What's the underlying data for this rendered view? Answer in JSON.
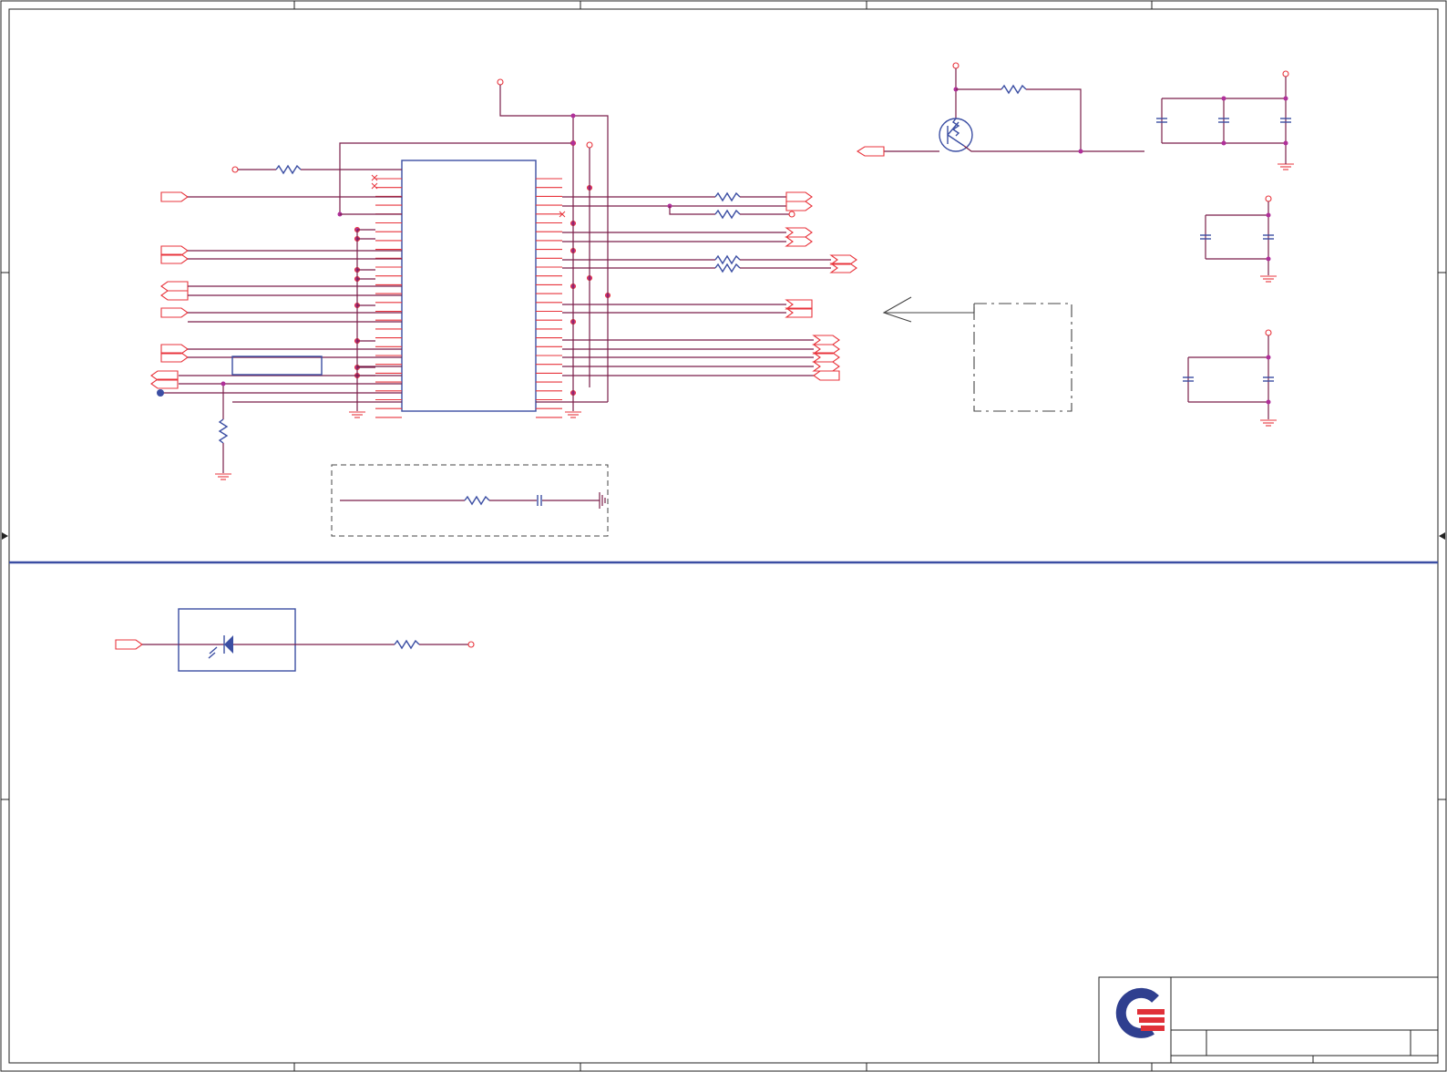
{
  "sheet": {
    "type": "schematic",
    "colors": {
      "wire": "#7a1f4a",
      "pin": "#e8343c",
      "component": "#3b4ea3",
      "junction": "#b0309a",
      "divider": "#3b4ea3",
      "logo_blue": "#2f3f8f",
      "logo_red": "#e03038"
    },
    "logo": "company-logo"
  }
}
